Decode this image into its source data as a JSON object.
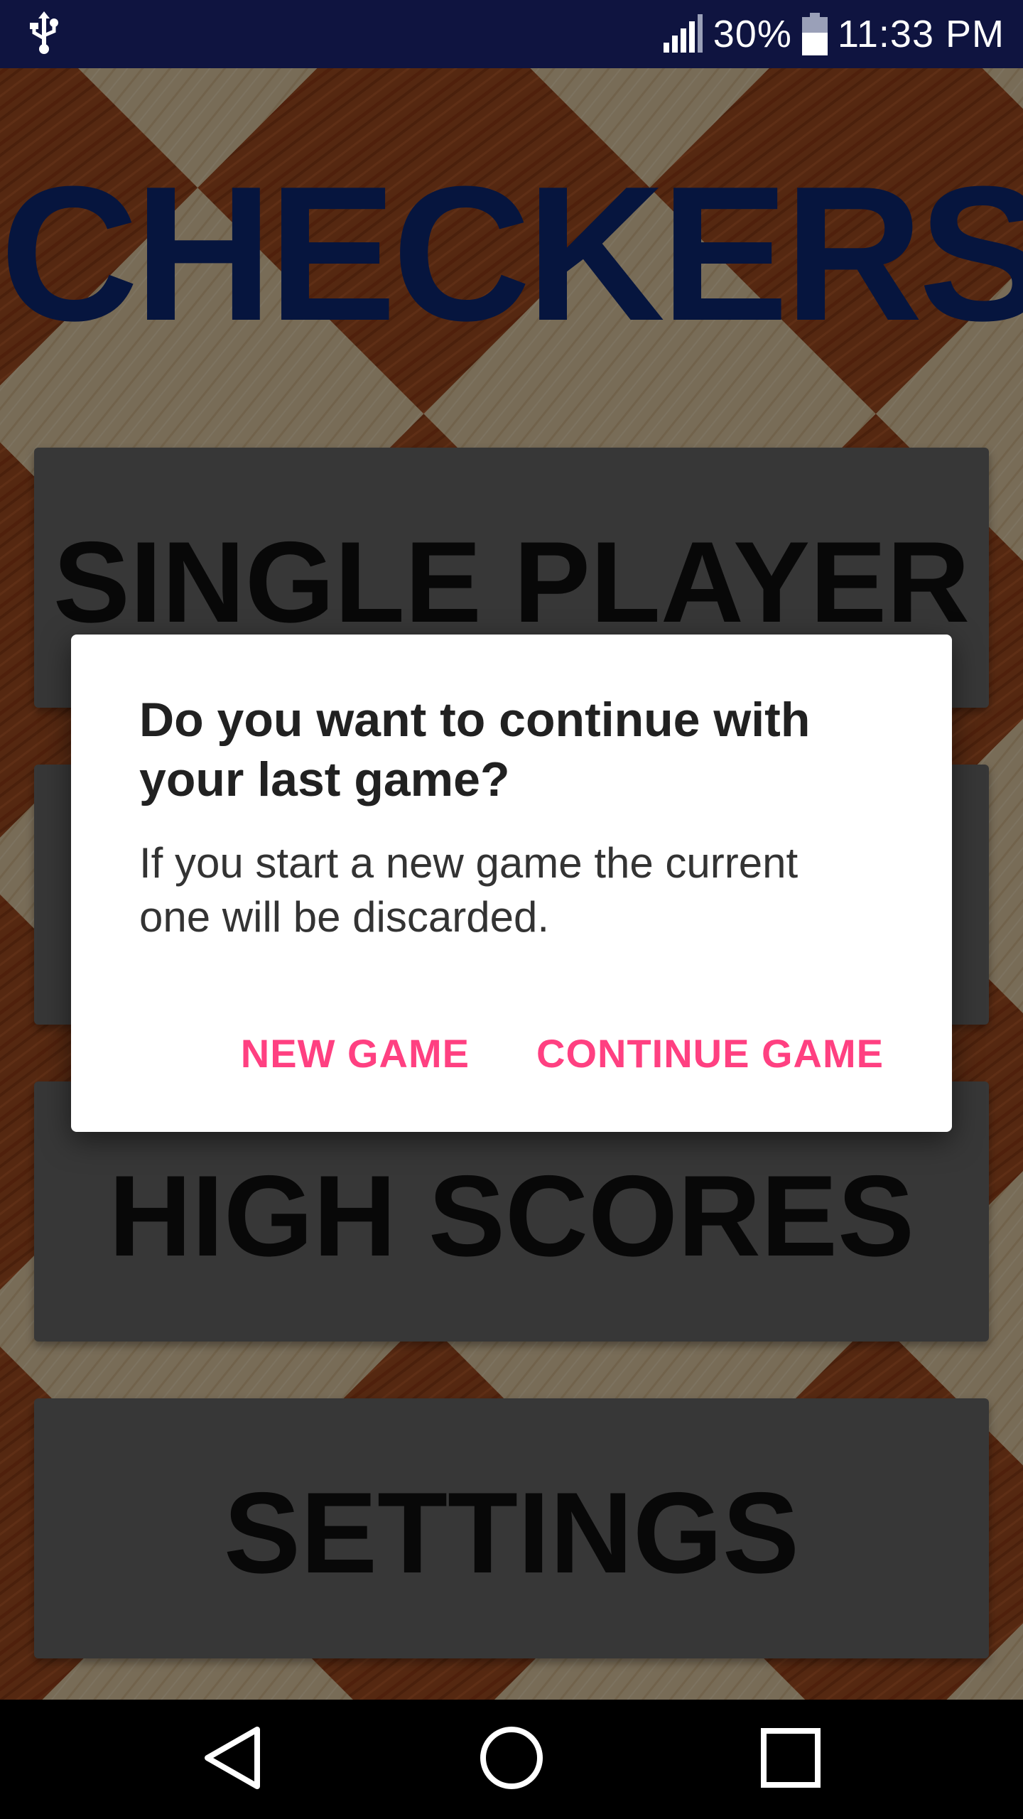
{
  "status_bar": {
    "usb_icon": "usb-icon",
    "signal_icon": "signal-icon",
    "battery_percent": "30%",
    "battery_icon": "battery-icon",
    "time": "11:33 PM"
  },
  "app": {
    "title": "CHECKERS",
    "title_color": "#0d2a78",
    "menu": [
      {
        "label": "SINGLE PLAYER"
      },
      {
        "label": ""
      },
      {
        "label": "HIGH SCORES"
      },
      {
        "label": "SETTINGS"
      }
    ]
  },
  "dialog": {
    "title": "Do you want to continue with your last game?",
    "message": "If you start a new game the current one will be discarded.",
    "new_game_label": "NEW GAME",
    "continue_label": "CONTINUE GAME",
    "accent_color": "#ff4081"
  },
  "nav_bar": {
    "back_icon": "back-triangle-icon",
    "home_icon": "home-circle-icon",
    "recents_icon": "recents-square-icon"
  }
}
